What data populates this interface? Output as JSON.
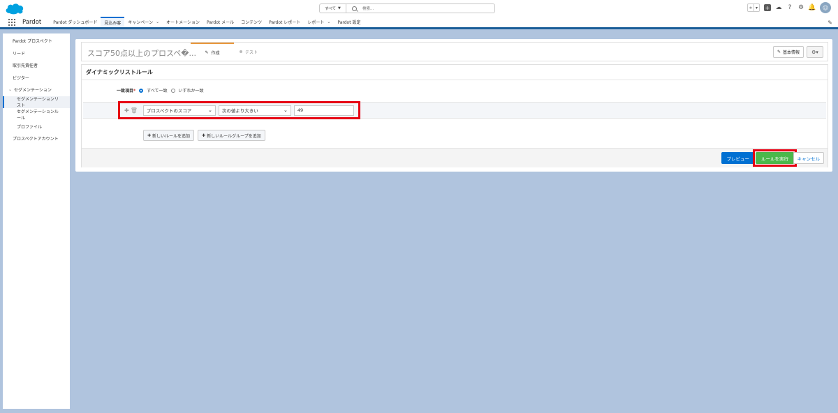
{
  "header": {
    "search_scope": "すべて",
    "search_placeholder": "検索..."
  },
  "navbar": {
    "app_name": "Pardot",
    "items": [
      {
        "label": "Pardot ダッシュボード",
        "has_menu": false
      },
      {
        "label": "見込み客",
        "has_menu": false,
        "active": true
      },
      {
        "label": "キャンペーン",
        "has_menu": true
      },
      {
        "label": "オートメーション",
        "has_menu": false
      },
      {
        "label": "Pardot メール",
        "has_menu": false
      },
      {
        "label": "コンテンツ",
        "has_menu": false
      },
      {
        "label": "Pardot レポート",
        "has_menu": false
      },
      {
        "label": "レポート",
        "has_menu": true
      },
      {
        "label": "Pardot 設定",
        "has_menu": false
      }
    ]
  },
  "sidebar": {
    "items": [
      {
        "label": "Pardot プロスペクト"
      },
      {
        "label": "リード"
      },
      {
        "label": "取引先責任者"
      },
      {
        "label": "ビジター"
      },
      {
        "label": "セグメンテーション"
      },
      {
        "label": "セグメンテーションリスト"
      },
      {
        "label": "セグメンテーションルール"
      },
      {
        "label": "プロファイル"
      },
      {
        "label": "プロスペクトアカウント"
      }
    ]
  },
  "page": {
    "title": "スコア50点以上のプロスペ�...",
    "tab_edit": "作成",
    "tab_test": "テスト",
    "basic_info_button": "基本情報"
  },
  "rules": {
    "section_title": "ダイナミックリストルール",
    "match_label": "一致項目",
    "match_all": "すべて一致",
    "match_any": "いずれか一致",
    "field_value": "プロスペクトのスコア",
    "operator_value": "次の値より大きい",
    "input_value": "49",
    "add_rule": "新しいルールを追加",
    "add_rule_group": "新しいルールグループを追加"
  },
  "footer": {
    "preview": "プレビュー",
    "run": "ルールを実行",
    "cancel": "キャンセル"
  },
  "colors": {
    "brand_blue": "#0070d2",
    "run_green": "#4bb84b",
    "highlight_red": "#e60012",
    "tab_orange": "#e8963a"
  }
}
